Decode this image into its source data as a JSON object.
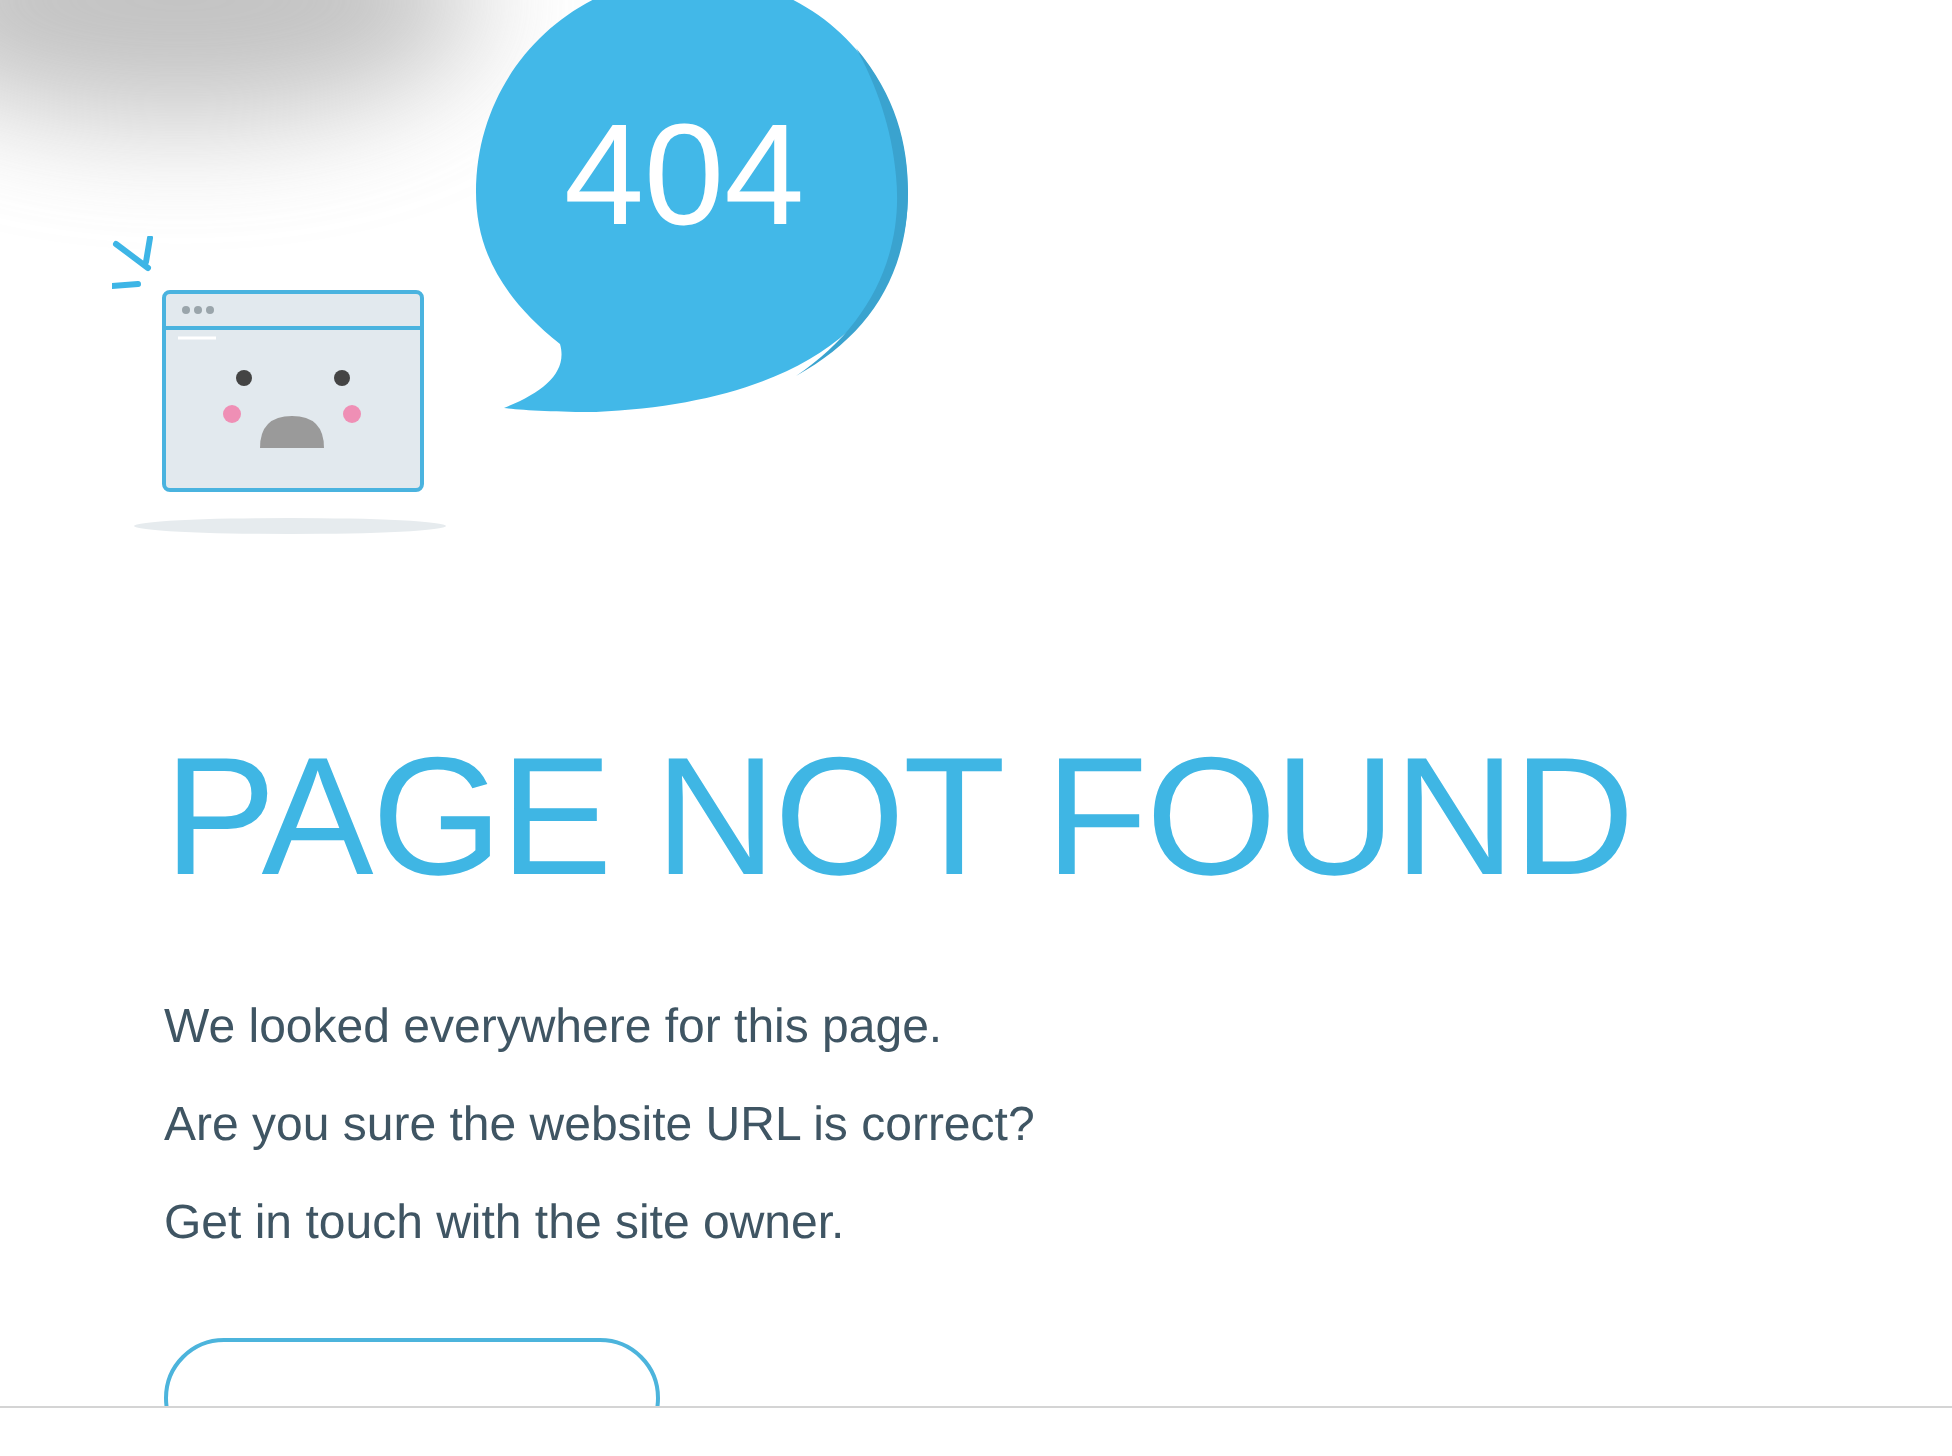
{
  "bubble": {
    "text": "404"
  },
  "heading": "PAGE NOT FOUND",
  "messages": [
    "We looked everywhere for this page.",
    "Are you sure the website URL is correct?",
    "Get in touch with the site owner."
  ]
}
